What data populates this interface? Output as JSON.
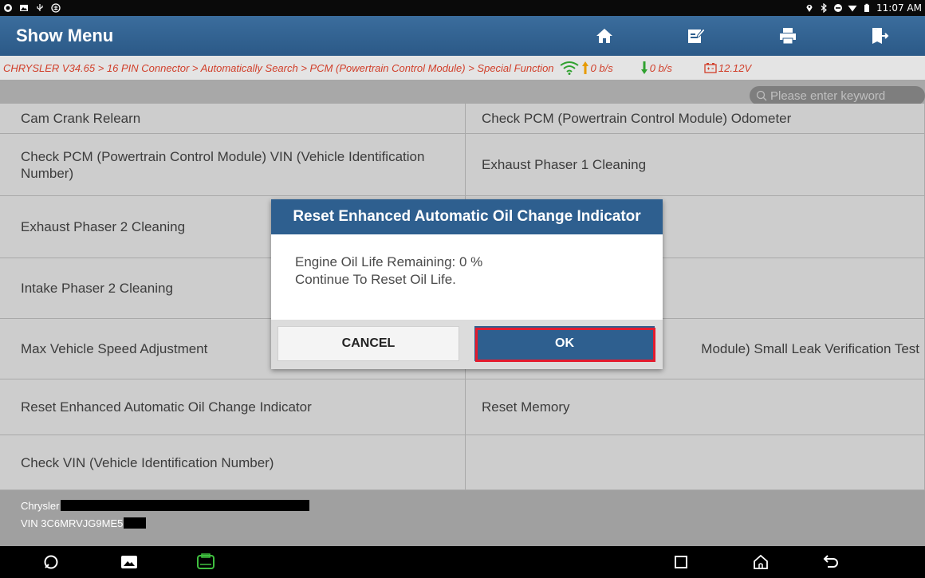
{
  "status_bar": {
    "time": "11:07 AM"
  },
  "app_bar": {
    "title": "Show Menu",
    "tools": [
      {
        "name": "home-icon"
      },
      {
        "name": "edit-report-icon"
      },
      {
        "name": "print-icon"
      },
      {
        "name": "exit-icon"
      }
    ]
  },
  "breadcrumb": {
    "path": "CHRYSLER V34.65 > 16 PIN Connector > Automatically Search > PCM (Powertrain Control Module) > Special Function",
    "upload_speed": "0 b/s",
    "download_speed": "0 b/s",
    "voltage": "12.12V"
  },
  "search": {
    "placeholder": "Please enter keyword"
  },
  "functions": {
    "left": [
      "Cam Crank Relearn",
      "Check PCM (Powertrain Control Module) VIN (Vehicle Identification Number)",
      "Exhaust Phaser 2 Cleaning",
      "Intake Phaser 2 Cleaning",
      "Max Vehicle Speed Adjustment",
      "Reset Enhanced Automatic Oil Change Indicator",
      "Check VIN (Vehicle Identification Number)"
    ],
    "right": [
      "Check PCM (Powertrain Control Module) Odometer",
      "Exhaust Phaser 1 Cleaning",
      "",
      "",
      "Module) Small Leak Verification Test",
      "Reset Memory",
      ""
    ]
  },
  "footer": {
    "make": "Chrysler",
    "vin": "VIN 3C6MRVJG9ME5"
  },
  "dialog": {
    "title": "Reset Enhanced Automatic Oil Change Indicator",
    "line1": "Engine Oil Life Remaining: 0 %",
    "line2": "Continue To Reset Oil Life.",
    "cancel_label": "CANCEL",
    "ok_label": "OK"
  },
  "colors": {
    "app_bar": "#2e5f8f",
    "breadcrumb_text": "#d13f2a",
    "highlight": "#e31b2e"
  }
}
